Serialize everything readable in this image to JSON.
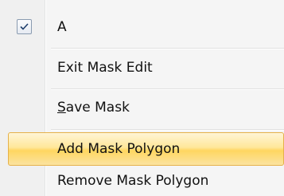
{
  "menu": {
    "items": [
      {
        "label": "A",
        "checked": true
      },
      {
        "label": "Exit Mask Edit"
      },
      {
        "label_access_key": "S",
        "label_rest": "ave Mask"
      },
      {
        "label": "Add Mask Polygon",
        "highlighted": true
      },
      {
        "label": "Remove Mask Polygon"
      }
    ]
  },
  "colors": {
    "highlight_border": "#e5b14a",
    "highlight_fill": "#ffd660",
    "background": "#f5f5f5"
  },
  "icons": {
    "checked_item": "checkmark-icon"
  }
}
